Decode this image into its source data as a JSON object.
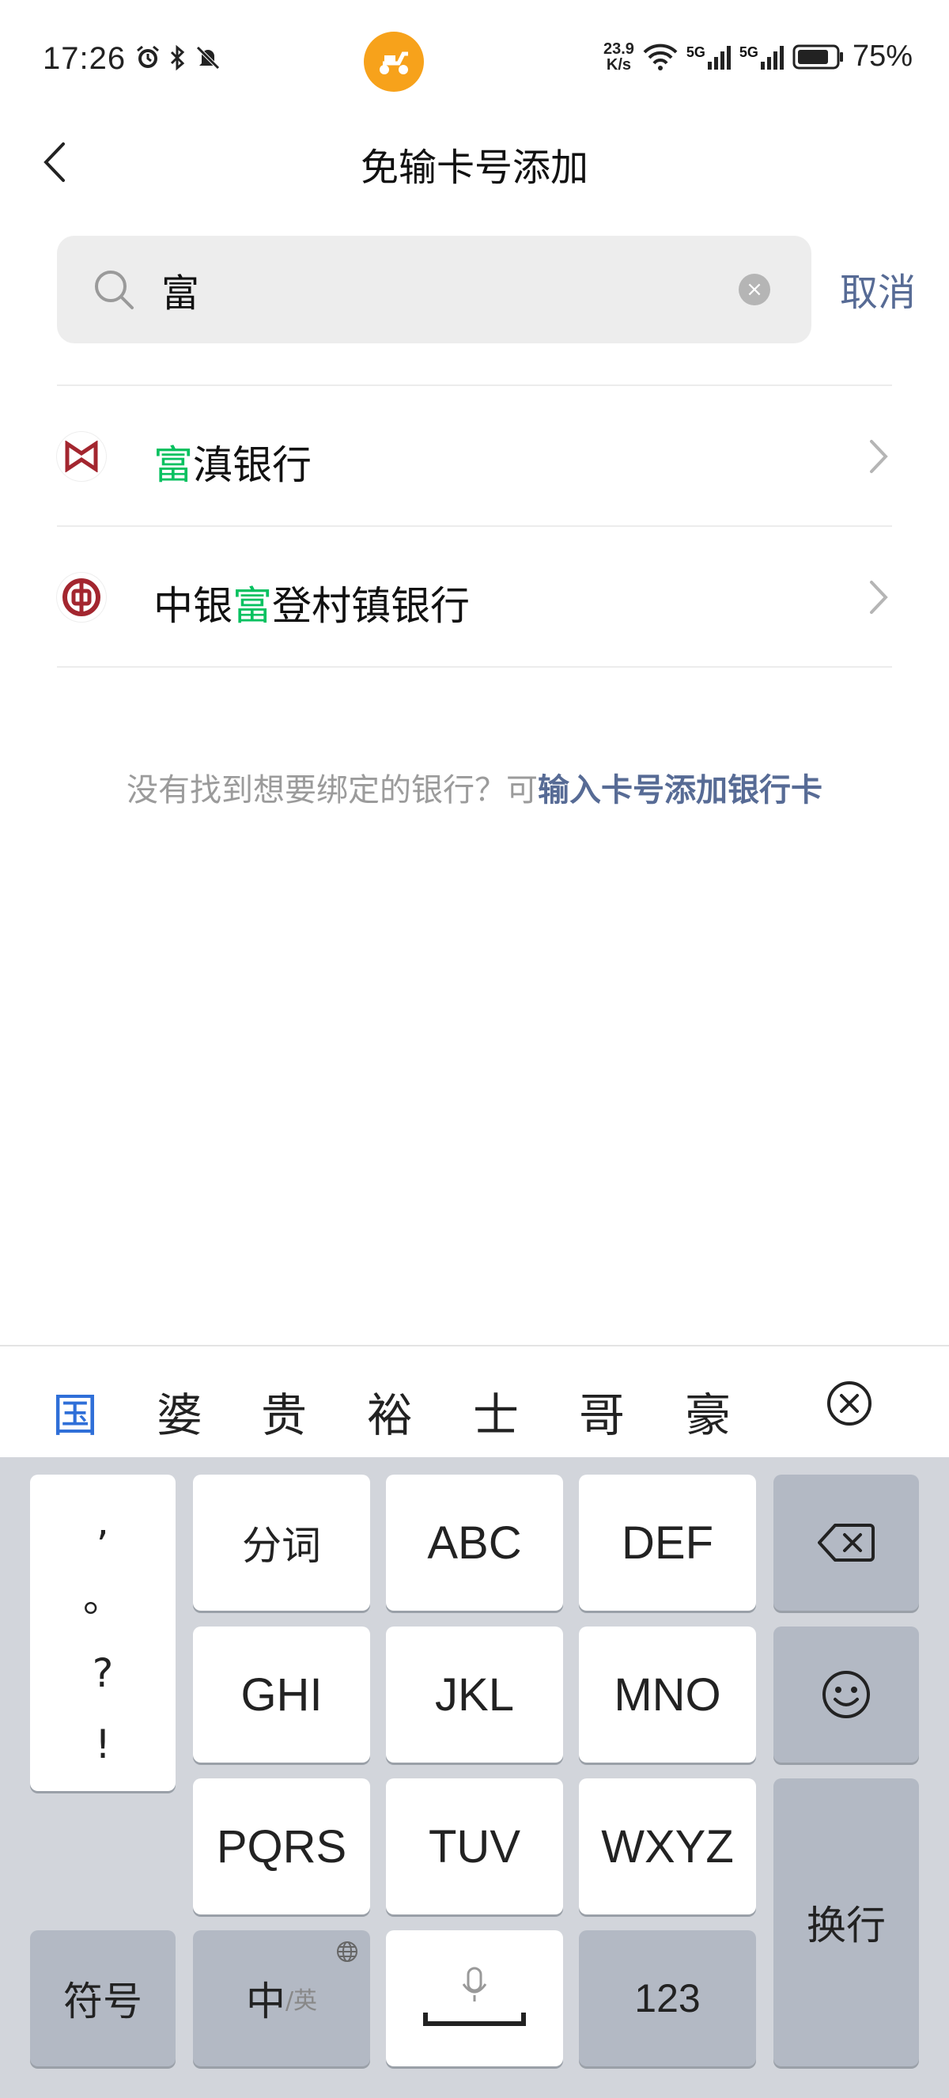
{
  "status_bar": {
    "time": "17:26",
    "net_speed_value": "23.9",
    "net_speed_unit": "K/s",
    "signal_1": "5G",
    "signal_2": "5G",
    "battery": "75%"
  },
  "nav": {
    "title": "免输卡号添加"
  },
  "search": {
    "value": "富",
    "placeholder": "",
    "cancel_label": "取消"
  },
  "results": [
    {
      "prefix": "",
      "highlight": "富",
      "suffix": "滇银行"
    },
    {
      "prefix": "中银",
      "highlight": "富",
      "suffix": "登村镇银行"
    }
  ],
  "hint": {
    "text": "没有找到想要绑定的银行？可",
    "link": "输入卡号添加银行卡"
  },
  "candidates": [
    "国",
    "婆",
    "贵",
    "裕",
    "士",
    "哥",
    "豪"
  ],
  "keyboard": {
    "punct": [
      ",",
      "。",
      "?",
      "!"
    ],
    "row1": [
      "分词",
      "ABC",
      "DEF"
    ],
    "row2": [
      "GHI",
      "JKL",
      "MNO"
    ],
    "row3": [
      "PQRS",
      "TUV",
      "WXYZ"
    ],
    "symbols": "符号",
    "lang_main": "中",
    "lang_sub": "/英",
    "numbers": "123",
    "enter": "换行"
  },
  "colors": {
    "accent_link": "#576b95",
    "highlight_green": "#07c160",
    "candidate_active": "#2f6fd8",
    "status_app_icon": "#f7a21b"
  }
}
